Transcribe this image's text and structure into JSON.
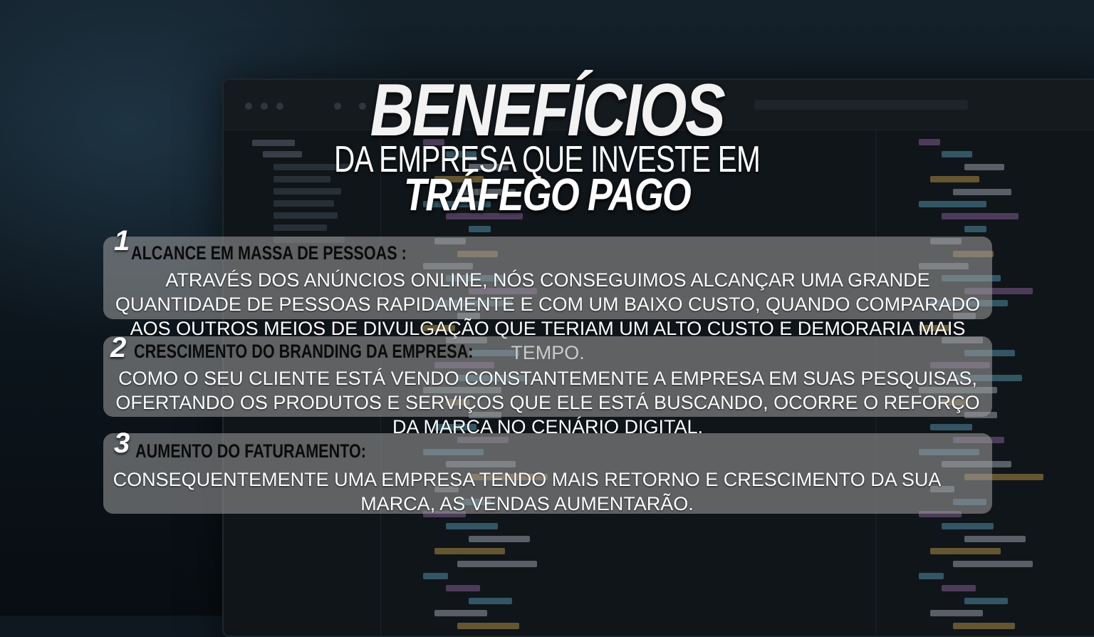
{
  "header": {
    "title": "BENEFÍCIOS",
    "subtitle": "DA EMPRESA QUE INVESTE EM",
    "highlight": "TRÁFEGO PAGO"
  },
  "benefits": [
    {
      "number": "1",
      "title": "ALCANCE EM MASSA DE PESSOAS :",
      "text": "ATRAVÉS DOS ANÚNCIOS ONLINE, NÓS CONSEGUIMOS ALCANÇAR UMA GRANDE QUANTIDADE DE PESSOAS RAPIDAMENTE E  COM UM BAIXO CUSTO, QUANDO COMPARADO AOS OUTROS MEIOS DE DIVULGAÇÃO QUE TERIAM UM ALTO CUSTO E DEMORARIA MAIS TEMPO."
    },
    {
      "number": "2",
      "title": "CRESCIMENTO DO BRANDING DA EMPRESA:",
      "text": "COMO O SEU CLIENTE ESTÁ VENDO CONSTANTEMENTE A EMPRESA EM SUAS PESQUISAS, OFERTANDO OS PRODUTOS E SERVIÇOS QUE ELE ESTÁ BUSCANDO, OCORRE O REFORÇO DA MARCA NO CENÁRIO DIGITAL."
    },
    {
      "number": "3",
      "title": "AUMENTO DO FATURAMENTO:",
      "text": "CONSEQUENTEMENTE UMA EMPRESA TENDO MAIS RETORNO E CRESCIMENTO DA SUA MARCA, AS VENDAS AUMENTARÃO."
    }
  ],
  "colors": {
    "card_background": "#a0a0a0",
    "title_text": "#0b0b0b",
    "body_text": "#ffffff"
  }
}
